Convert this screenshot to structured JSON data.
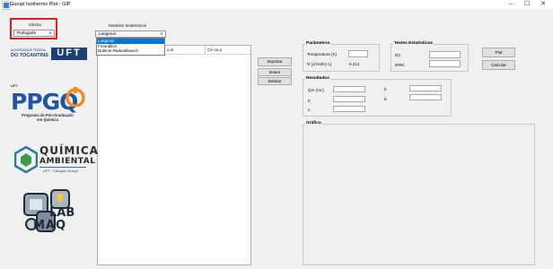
{
  "window": {
    "title": "Gurupi Isotherms Plot - GIP",
    "controls": {
      "minimize": "–",
      "maximize": "☐",
      "close": "✕"
    }
  },
  "language": {
    "label": "Idioma",
    "selected": "Português",
    "chevron": "∨"
  },
  "models": {
    "label": "Modelos Isotérmicos",
    "selected": "Langmuir",
    "chevron": "∨",
    "options": [
      "Langmuir",
      "Freundlich",
      "Dubinin-Raduskhevich"
    ]
  },
  "table": {
    "columns": [
      "",
      "Ce ou p"
    ],
    "partial_header": "a ie"
  },
  "actions": {
    "import": "Importar",
    "insert": "Inserir",
    "delete": "Deletar",
    "plot": "Plot",
    "calculate": "Calcular"
  },
  "parameters": {
    "title": "Parâmetros",
    "temperature_label": "Temperatura (K)",
    "temperature_value": "",
    "r_label": "R (J/molK)-1)",
    "r_value": "8.314"
  },
  "statistics": {
    "title": "Testes Estatísticos",
    "r2_label": "R2",
    "erm_label": "ERM"
  },
  "results": {
    "title": "Resultados",
    "qm_label": "Qm (mc)",
    "b_label": "b",
    "k_label": "K",
    "e_label": "E",
    "n_label": "n"
  },
  "graph": {
    "title": "Gráfico"
  },
  "logos": {
    "uft_left_line1": "UNIVERSIDADE FEDERAL",
    "uft_left_line2": "DO TOCANTINS",
    "uft_right": "UFT",
    "uft_small": "UFT",
    "ppgq": "PPGQ",
    "ppgq_sub_line1": "Programa de Pós-Graduação",
    "ppgq_sub_line2": "em Química",
    "quimica": "QUÍMICA",
    "ambiental": "AMBIENTAL",
    "quimica_sub": "UFT - Câmpus Gurupi",
    "lab1": "LAB",
    "lab2": "MAQ",
    "brand_blue": "#2255a0",
    "brand_navy": "#1c3f79"
  }
}
